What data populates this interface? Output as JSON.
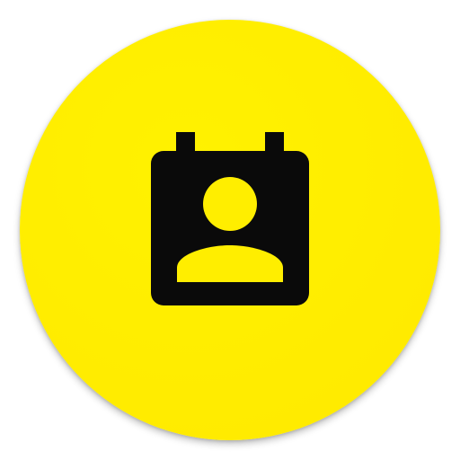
{
  "app_icon": {
    "icon": "contact-calendar-icon",
    "background_color": "#FFEE00",
    "glyph_color": "#0A0A0A"
  }
}
